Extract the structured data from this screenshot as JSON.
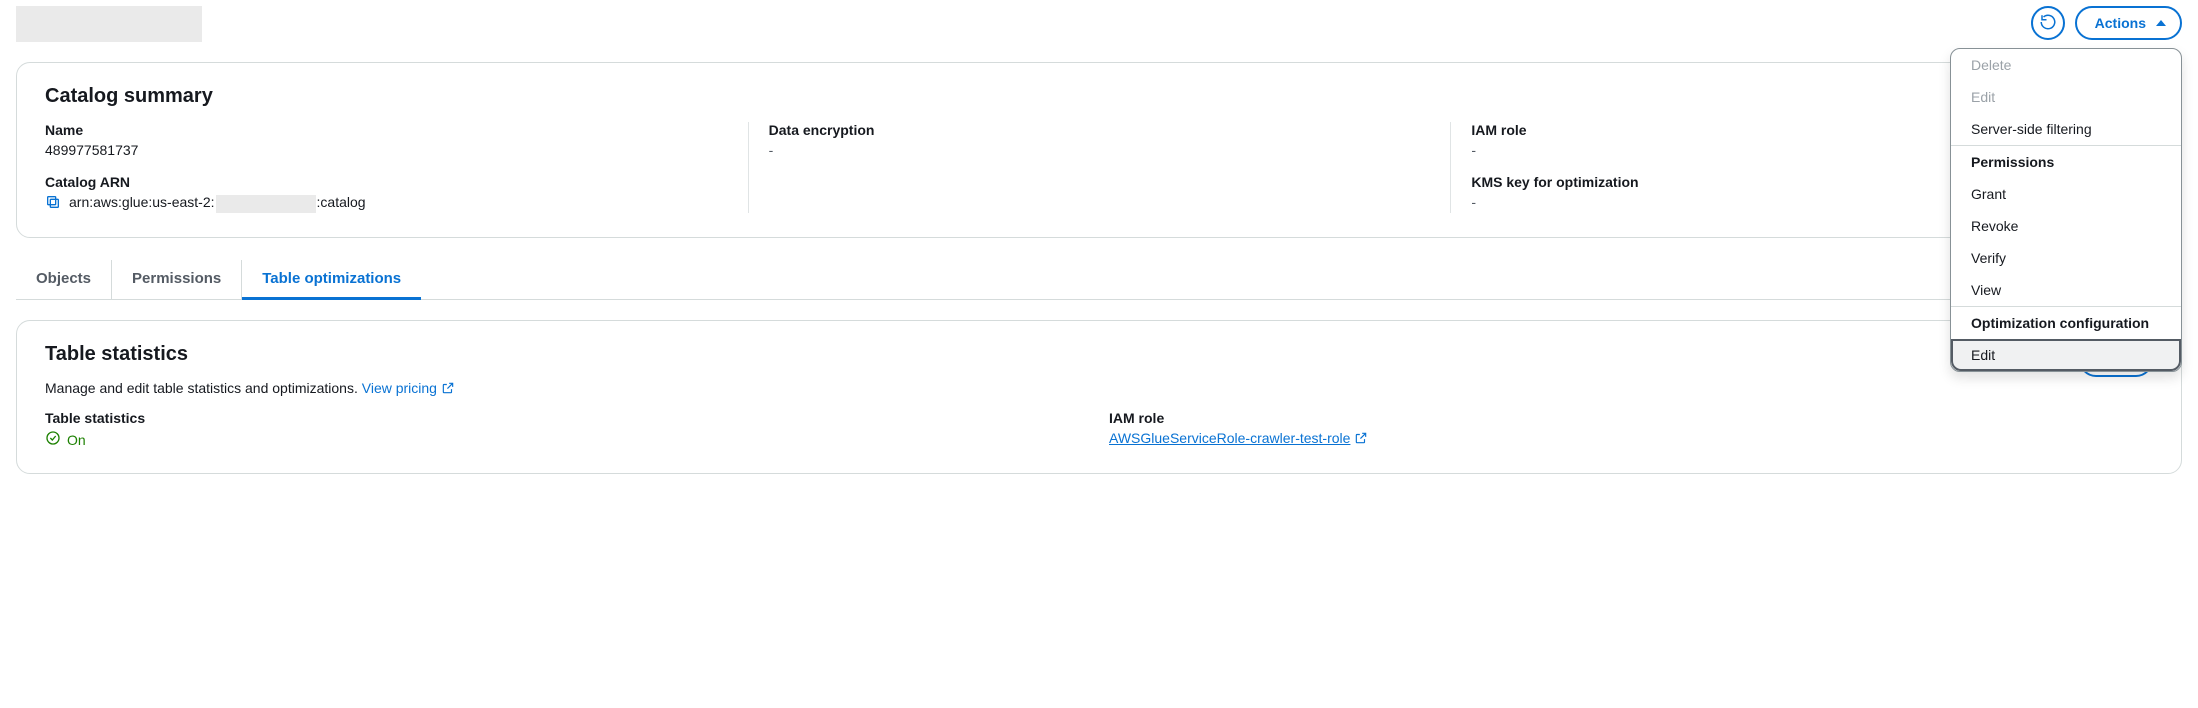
{
  "header": {
    "actions_label": "Actions"
  },
  "dropdown": {
    "delete": "Delete",
    "edit": "Edit",
    "ssf": "Server-side filtering",
    "permissions_head": "Permissions",
    "grant": "Grant",
    "revoke": "Revoke",
    "verify": "Verify",
    "view": "View",
    "opt_head": "Optimization configuration",
    "opt_edit": "Edit"
  },
  "summary": {
    "title": "Catalog summary",
    "name_label": "Name",
    "name_value": "489977581737",
    "arn_label": "Catalog ARN",
    "arn_prefix": "arn:aws:glue:us-east-2:",
    "arn_suffix": ":catalog",
    "data_enc_label": "Data encryption",
    "data_enc_value": "-",
    "iam_label": "IAM role",
    "iam_value": "-",
    "kms_label": "KMS key for optimization",
    "kms_value": "-"
  },
  "tabs": {
    "objects": "Objects",
    "permissions": "Permissions",
    "table_opt": "Table optimizations"
  },
  "stats": {
    "title": "Table statistics",
    "subtext": "Manage and edit table statistics and optimizations. ",
    "pricing_link": "View pricing",
    "edit_btn": "Edit",
    "ts_label": "Table statistics",
    "ts_value": "On",
    "iam_label": "IAM role",
    "iam_value": "AWSGlueServiceRole-crawler-test-role"
  }
}
